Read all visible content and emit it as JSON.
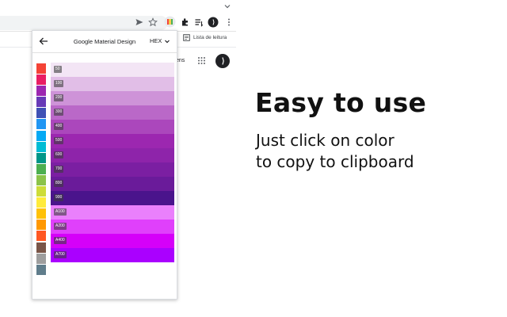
{
  "browser": {
    "bookmark_reading_list": "Lista de leitura",
    "google_images_label": "ens"
  },
  "popup": {
    "title": "Google Material Design",
    "format": "HEX",
    "palette_swatches": [
      "#f44336",
      "#e91e63",
      "#9c27b0",
      "#673ab7",
      "#3f51b5",
      "#2196f3",
      "#03a9f4",
      "#00bcd4",
      "#009688",
      "#4caf50",
      "#8bc34a",
      "#cddc39",
      "#ffeb3b",
      "#ffc107",
      "#ff9800",
      "#ff5722",
      "#795548",
      "#9e9e9e",
      "#607d8b"
    ],
    "selected_palette": "Purple",
    "shades": [
      {
        "label": "50",
        "color": "#f3e5f5"
      },
      {
        "label": "100",
        "color": "#e1bee7"
      },
      {
        "label": "200",
        "color": "#ce93d8"
      },
      {
        "label": "300",
        "color": "#ba68c8"
      },
      {
        "label": "400",
        "color": "#ab47bc"
      },
      {
        "label": "500",
        "color": "#9c27b0"
      },
      {
        "label": "600",
        "color": "#8e24aa"
      },
      {
        "label": "700",
        "color": "#7b1fa2"
      },
      {
        "label": "800",
        "color": "#6a1b9a"
      },
      {
        "label": "900",
        "color": "#4a148c"
      },
      {
        "label": "A100",
        "color": "#ea80fc"
      },
      {
        "label": "A200",
        "color": "#e040fb"
      },
      {
        "label": "A400",
        "color": "#d500f9"
      },
      {
        "label": "A700",
        "color": "#aa00ff"
      }
    ]
  },
  "promo": {
    "headline": "Easy to use",
    "subline_1": "Just click on color",
    "subline_2": "to copy to clipboard"
  }
}
